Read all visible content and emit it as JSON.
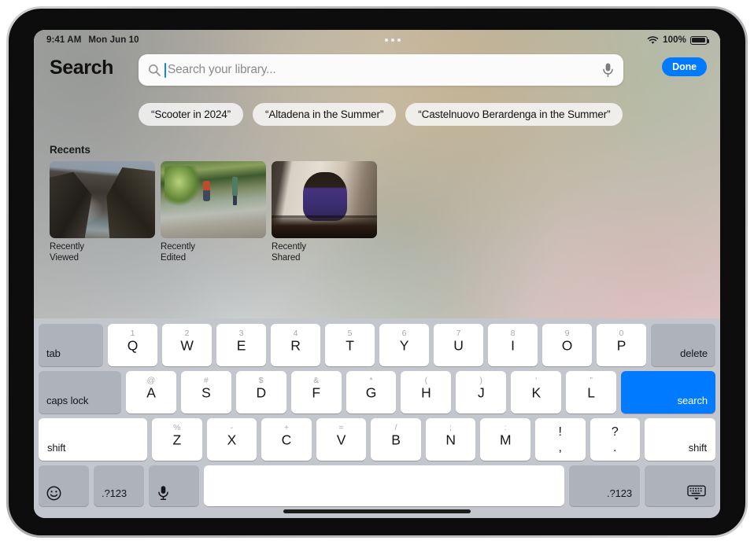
{
  "status_bar": {
    "time": "9:41 AM",
    "date": "Mon Jun 10",
    "wifi_icon": "wifi-icon",
    "battery_percent": "100%",
    "battery_icon": "battery-full-icon",
    "multitask_icon": "multitasking-dots-icon"
  },
  "header": {
    "title": "Search",
    "done_label": "Done"
  },
  "search": {
    "placeholder": "Search your library...",
    "value": "",
    "search_icon": "search-icon",
    "mic_icon": "microphone-icon"
  },
  "suggestions": [
    {
      "label": "“Scooter in 2024”"
    },
    {
      "label": "“Altadena in the Summer”"
    },
    {
      "label": "“Castelnuovo Berardenga in the Summer”"
    }
  ],
  "recents": {
    "title": "Recents",
    "items": [
      {
        "label": "Recently\nViewed",
        "thumb": "coastal-cliffs-photo"
      },
      {
        "label": "Recently\nEdited",
        "thumb": "creek-hikers-photo"
      },
      {
        "label": "Recently\nShared",
        "thumb": "girl-playing-chess-photo"
      }
    ]
  },
  "keyboard": {
    "accent_color": "#007aff",
    "modifier_key_color": "#adb2bb",
    "key_color": "#ffffff",
    "background_color": "#c3c6cc",
    "row1": {
      "tab": "tab",
      "keys": [
        {
          "alt": "1",
          "main": "Q"
        },
        {
          "alt": "2",
          "main": "W"
        },
        {
          "alt": "3",
          "main": "E"
        },
        {
          "alt": "4",
          "main": "R"
        },
        {
          "alt": "5",
          "main": "T"
        },
        {
          "alt": "6",
          "main": "Y"
        },
        {
          "alt": "7",
          "main": "U"
        },
        {
          "alt": "8",
          "main": "I"
        },
        {
          "alt": "9",
          "main": "O"
        },
        {
          "alt": "0",
          "main": "P"
        }
      ],
      "delete": "delete"
    },
    "row2": {
      "caps_lock": "caps lock",
      "keys": [
        {
          "alt": "@",
          "main": "A"
        },
        {
          "alt": "#",
          "main": "S"
        },
        {
          "alt": "$",
          "main": "D"
        },
        {
          "alt": "&",
          "main": "F"
        },
        {
          "alt": "*",
          "main": "G"
        },
        {
          "alt": "(",
          "main": "H"
        },
        {
          "alt": ")",
          "main": "J"
        },
        {
          "alt": "‘",
          "main": "K"
        },
        {
          "alt": "”",
          "main": "L"
        }
      ],
      "search": "search"
    },
    "row3": {
      "shift_left": "shift",
      "keys": [
        {
          "alt": "%",
          "main": "Z"
        },
        {
          "alt": "-",
          "main": "X"
        },
        {
          "alt": "+",
          "main": "C"
        },
        {
          "alt": "=",
          "main": "V"
        },
        {
          "alt": "/",
          "main": "B"
        },
        {
          "alt": ";",
          "main": "N"
        },
        {
          "alt": ":",
          "main": "M"
        }
      ],
      "punct": [
        {
          "top": "!",
          "bottom": ","
        },
        {
          "top": "?",
          "bottom": "."
        }
      ],
      "shift_right": "shift"
    },
    "row4": {
      "emoji_icon": "emoji-smiley-icon",
      "numbers_left": ".?123",
      "mic_icon": "microphone-icon",
      "space": "",
      "numbers_right": ".?123",
      "dismiss_icon": "hide-keyboard-icon"
    }
  }
}
